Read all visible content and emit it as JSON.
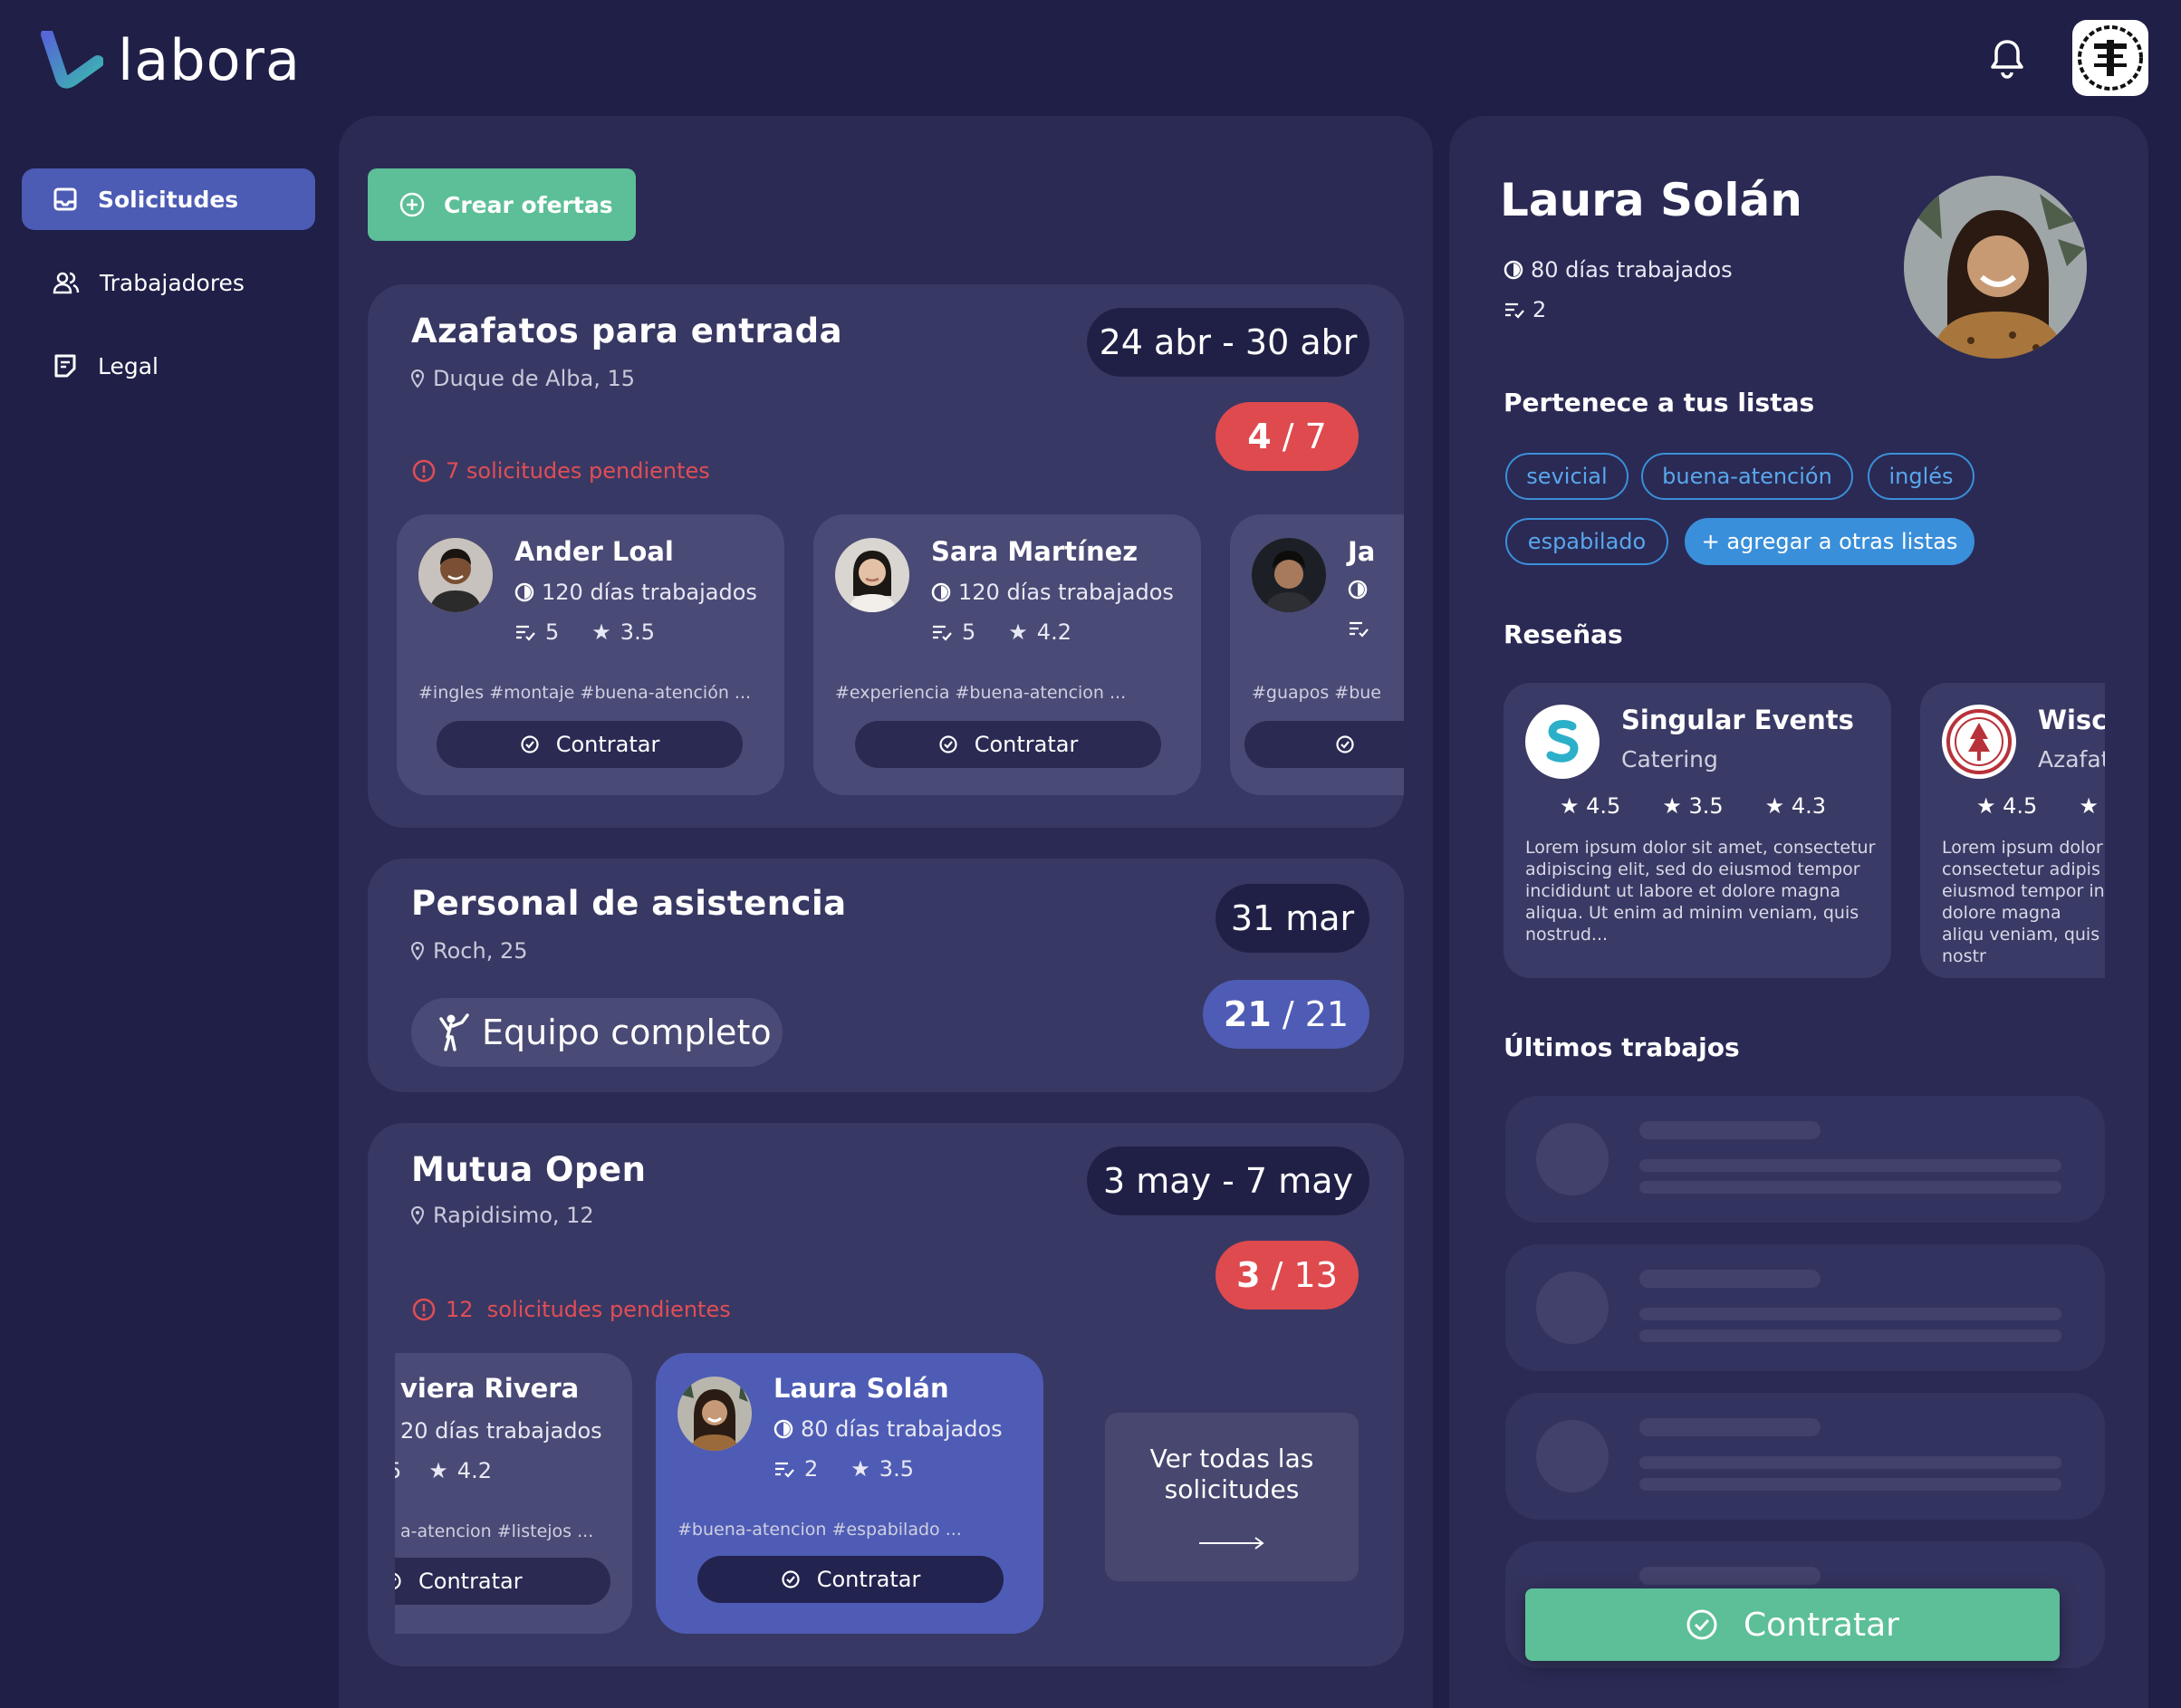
{
  "app": {
    "name": "labora"
  },
  "sidebar": {
    "items": [
      {
        "label": "Solicitudes",
        "icon": "inbox-icon",
        "active": true
      },
      {
        "label": "Trabajadores",
        "icon": "users-icon"
      },
      {
        "label": "Legal",
        "icon": "document-icon"
      }
    ]
  },
  "toolbar": {
    "create_label": "Crear ofertas"
  },
  "requests": [
    {
      "title": "Azafatos para entrada",
      "location": "Duque de Alba, 15",
      "dates": "24 abr - 30 abr",
      "filled": "4",
      "total": "/ 7",
      "pending": "7 solicitudes pendientes",
      "workers": [
        {
          "name": "Ander Loal",
          "days": "120 días trabajados",
          "jobs": "5",
          "rating": "3.5",
          "tags": "#ingles #montaje #buena-atención ...",
          "hire": "Contratar"
        },
        {
          "name": "Sara Martínez",
          "days": "120 días trabajados",
          "jobs": "5",
          "rating": "4.2",
          "tags": "#experiencia #buena-atencion ...",
          "hire": "Contratar"
        },
        {
          "name": "Ja",
          "tags": "#guapos #bue"
        }
      ]
    },
    {
      "title": "Personal de asistencia",
      "location": "Roch, 25",
      "dates": "31 mar",
      "filled": "21",
      "total": "/ 21",
      "status": "Equipo completo"
    },
    {
      "title": "Mutua Open",
      "location": "Rapidisimo, 12",
      "dates": "3 may - 7 may",
      "filled": "3",
      "total": "/ 13",
      "pending": "12  solicitudes pendientes",
      "workers": [
        {
          "name": "viera Rivera",
          "days": "20 días trabajados",
          "jobs": "5",
          "rating": "4.2",
          "tags": "a-atencion #listejos ...",
          "hire": "Contratar"
        },
        {
          "name": "Laura Solán",
          "days": "80 días trabajados",
          "jobs": "2",
          "rating": "3.5",
          "tags": "#buena-atencion #espabilado ...",
          "hire": "Contratar"
        }
      ],
      "see_all": "Ver todas las solicitudes"
    }
  ],
  "profile": {
    "name": "Laura Solán",
    "days": "80 días trabajados",
    "jobs": "2",
    "lists_title": "Pertenece a tus listas",
    "lists": [
      "sevicial",
      "buena-atención",
      "inglés",
      "espabilado"
    ],
    "add_list": "+ agregar a otras listas",
    "reviews_title": "Reseñas",
    "reviews": [
      {
        "name": "Singular Events",
        "category": "Catering",
        "ratings": [
          "4.5",
          "3.5",
          "4.3"
        ],
        "text": "Lorem ipsum dolor sit amet, consectetur adipiscing elit, sed do eiusmod tempor incididunt ut labore et dolore magna aliqua. Ut enim ad minim veniam, quis nostrud..."
      },
      {
        "name": "Wisco",
        "category": "Azafat",
        "ratings": [
          "4.5"
        ],
        "text": "Lorem ipsum dolor consectetur adipis eiusmod tempor in dolore magna aliqu veniam, quis nostr"
      }
    ],
    "jobs_title": "Últimos trabajos",
    "hire": "Contratar"
  },
  "colors": {
    "bg": "#1f1f47",
    "panel": "#2a2a55",
    "card": "#383864",
    "accent_blue": "#4e5cb5",
    "green": "#5cbf97",
    "red": "#df4a4f",
    "chip_blue": "#3a8fda"
  }
}
